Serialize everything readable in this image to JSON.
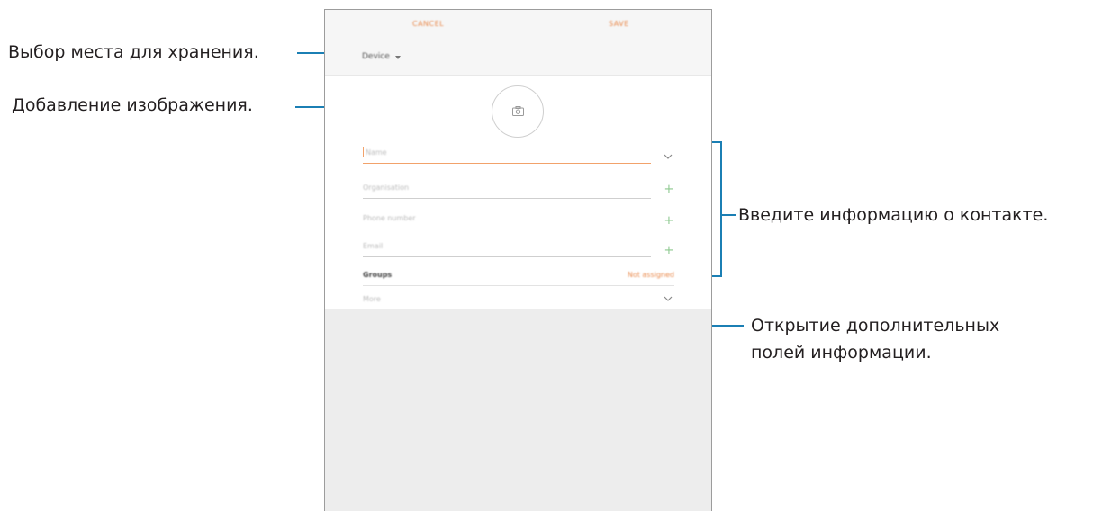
{
  "callouts": {
    "storage": "Выбор места для хранения.",
    "image": "Добавление изображения.",
    "info": "Введите информацию о контакте.",
    "more_line1": "Открытие дополнительных",
    "more_line2": "полей информации."
  },
  "screen": {
    "cancel_label": "CANCEL",
    "save_label": "SAVE",
    "storage_label": "Device",
    "fields": {
      "name_placeholder": "Name",
      "organisation_placeholder": "Organisation",
      "phone_placeholder": "Phone number",
      "email_placeholder": "Email"
    },
    "groups_label": "Groups",
    "groups_value": "Not assigned",
    "more_label": "More"
  },
  "colors": {
    "accent": "#e98a4d",
    "callout_line": "#1b7fb4",
    "plus": "#8dc98f"
  },
  "icons": [
    "camera-icon",
    "caret-down-icon",
    "chevron-down-icon",
    "plus-icon"
  ]
}
